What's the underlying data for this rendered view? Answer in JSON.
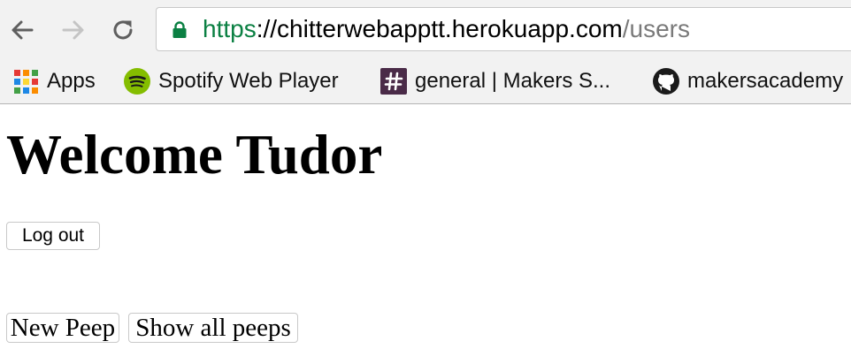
{
  "browser": {
    "url": {
      "scheme": "https",
      "separator": "://",
      "host": "chitterwebapptt.herokuapp.com",
      "path": "/users"
    },
    "bookmarks": [
      {
        "label": "Apps",
        "icon": "apps-grid-icon"
      },
      {
        "label": "Spotify Web Player",
        "icon": "spotify-icon"
      },
      {
        "label": "general | Makers S...",
        "icon": "slack-hash-icon"
      },
      {
        "label": "makersacademy",
        "icon": "github-icon"
      }
    ]
  },
  "page": {
    "heading": "Welcome Tudor",
    "logout_label": "Log out",
    "new_peep_label": "New Peep",
    "show_all_label": "Show all peeps"
  },
  "colors": {
    "secure_green": "#0b8043",
    "chrome_bg": "#f2f2f2",
    "spotify_green": "#84bd00",
    "slack_purple": "#4a2b48"
  }
}
